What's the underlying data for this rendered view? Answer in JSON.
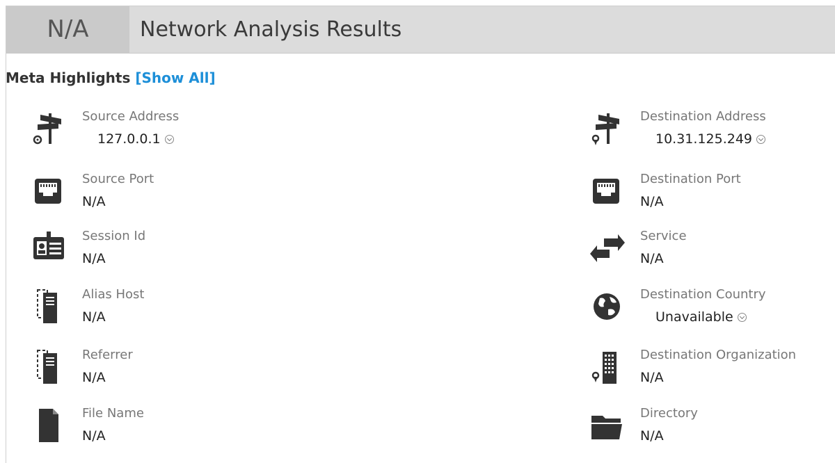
{
  "header": {
    "score": "N/A",
    "title": "Network Analysis Results"
  },
  "meta": {
    "heading": "Meta Highlights",
    "show_all": "[Show All]"
  },
  "left": [
    {
      "label": "Source Address",
      "value": "127.0.0.1",
      "icon": "signpost-icon"
    },
    {
      "label": "Source Port",
      "value": "N/A",
      "icon": "network-port-icon"
    },
    {
      "label": "Session Id",
      "value": "N/A",
      "icon": "id-card-icon"
    },
    {
      "label": "Alias Host",
      "value": "N/A",
      "icon": "server-icon"
    },
    {
      "label": "Referrer",
      "value": "N/A",
      "icon": "server-icon"
    },
    {
      "label": "File Name",
      "value": "N/A",
      "icon": "file-icon"
    }
  ],
  "right": [
    {
      "label": "Destination Address",
      "value": "10.31.125.249",
      "icon": "signpost-pin-icon"
    },
    {
      "label": "Destination Port",
      "value": "N/A",
      "icon": "network-port-icon"
    },
    {
      "label": "Service",
      "value": "N/A",
      "icon": "exchange-arrows-icon"
    },
    {
      "label": "Destination Country",
      "value": "Unavailable",
      "icon": "globe-icon"
    },
    {
      "label": "Destination Organization",
      "value": "N/A",
      "icon": "building-icon"
    },
    {
      "label": "Directory",
      "value": "N/A",
      "icon": "folder-icon"
    }
  ]
}
